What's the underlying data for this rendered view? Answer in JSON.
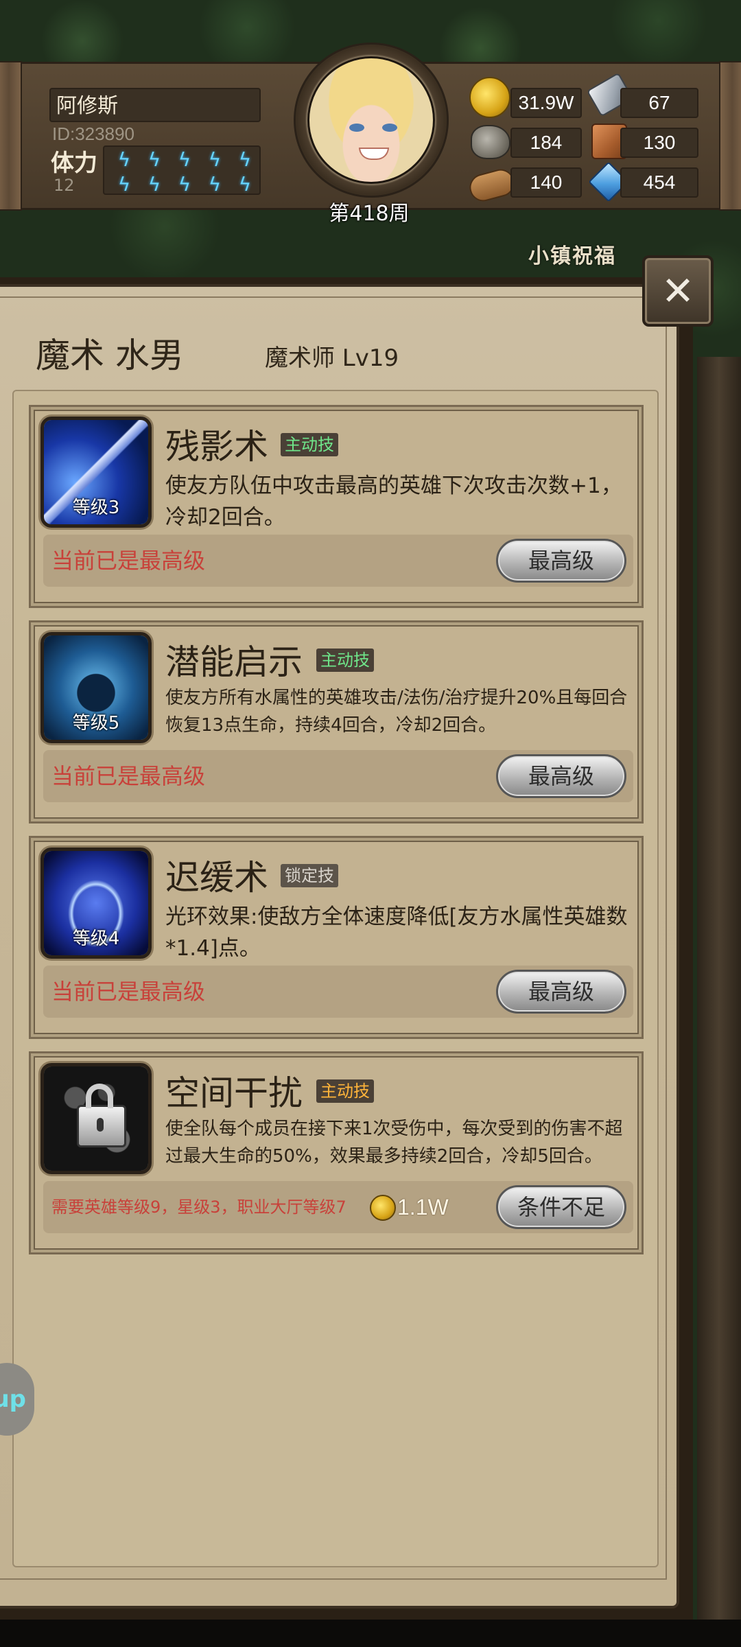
{
  "player": {
    "name": "阿修斯",
    "id_text": "ID:323890",
    "stamina_label": "体力",
    "stamina_value": "12",
    "stamina_bolts": 10,
    "week_label": "第418周"
  },
  "resources": {
    "gold": "31.9W",
    "iron": "67",
    "stone": "184",
    "leather": "130",
    "wood": "140",
    "crystal": "454"
  },
  "background": {
    "banner_text": "小镇祝福"
  },
  "hero": {
    "name": "魔术 水男",
    "class_level": "魔术师 Lv19"
  },
  "skills": [
    {
      "name": "残影术",
      "tag": "主动技",
      "level": "等级3",
      "description": "使友方队伍中攻击最高的英雄下次攻击次数+1，冷却2回合。",
      "status": "当前已是最高级",
      "button": "最高级"
    },
    {
      "name": "潜能启示",
      "tag": "主动技",
      "level": "等级5",
      "description": "使友方所有水属性的英雄攻击/法伤/治疗提升20%且每回合恢复13点生命，持续4回合，冷却2回合。",
      "status": "当前已是最高级",
      "button": "最高级"
    },
    {
      "name": "迟缓术",
      "tag": "锁定技",
      "level": "等级4",
      "description": "光环效果:使敌方全体速度降低[友方水属性英雄数*1.4]点。",
      "status": "当前已是最高级",
      "button": "最高级"
    },
    {
      "name": "空间干扰",
      "tag": "主动技",
      "description": "使全队每个成员在接下来1次受伤中，每次受到的伤害不超过最大生命的50%，效果最多持续2回合，冷却5回合。",
      "requirement": "需要英雄等级9，星级3，职业大厅等级7",
      "cost": "1.1W",
      "button": "条件不足"
    }
  ],
  "left_bubble": "up",
  "colors": {
    "status_red": "#c8413a",
    "tag_active_green": "#6fe68a",
    "tag_locked_gray": "#d9d4cc",
    "tag_orange": "#ffb43a",
    "panel_bg": "#c6b697"
  }
}
